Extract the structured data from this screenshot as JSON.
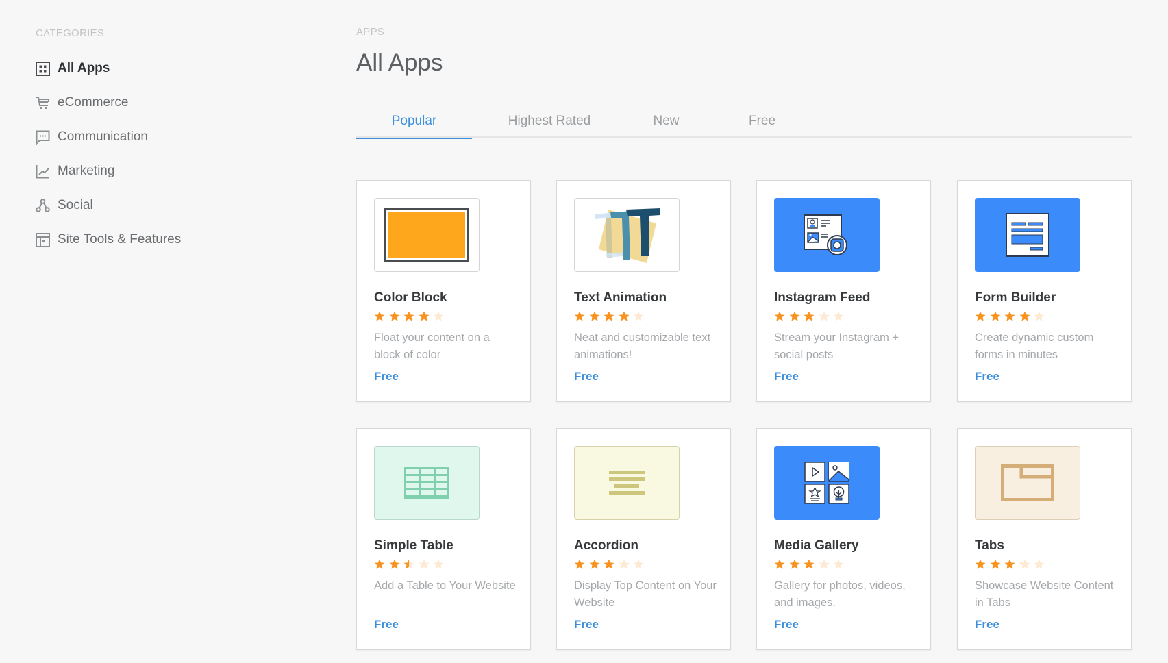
{
  "sidebar": {
    "heading": "CATEGORIES",
    "items": [
      {
        "label": "All Apps",
        "icon": "grid-icon",
        "active": true
      },
      {
        "label": "eCommerce",
        "icon": "cart-icon",
        "active": false
      },
      {
        "label": "Communication",
        "icon": "chat-bubble-icon",
        "active": false
      },
      {
        "label": "Marketing",
        "icon": "line-chart-icon",
        "active": false
      },
      {
        "label": "Social",
        "icon": "share-nodes-icon",
        "active": false
      },
      {
        "label": "Site Tools & Features",
        "icon": "layout-icon",
        "active": false
      }
    ]
  },
  "main": {
    "breadcrumb": "APPS",
    "title": "All Apps",
    "tabs": [
      {
        "label": "Popular",
        "active": true
      },
      {
        "label": "Highest Rated",
        "active": false
      },
      {
        "label": "New",
        "active": false
      },
      {
        "label": "Free",
        "active": false
      }
    ]
  },
  "apps": [
    {
      "name": "Color Block",
      "rating": 4,
      "description": "Float your content on a block of color",
      "price": "Free",
      "icon": "color-block-icon"
    },
    {
      "name": "Text Animation",
      "rating": 4,
      "description": "Neat and customizable text animations!",
      "price": "Free",
      "icon": "text-animation-icon"
    },
    {
      "name": "Instagram Feed",
      "rating": 3,
      "description": "Stream your Instagram + social posts",
      "price": "Free",
      "icon": "instagram-feed-icon"
    },
    {
      "name": "Form Builder",
      "rating": 4,
      "description": "Create dynamic custom forms in minutes",
      "price": "Free",
      "icon": "form-builder-icon"
    },
    {
      "name": "Simple Table",
      "rating": 2.5,
      "description": "Add a Table to Your Website",
      "price": "Free",
      "icon": "table-icon"
    },
    {
      "name": "Accordion",
      "rating": 3,
      "description": "Display Top Content on Your Website",
      "price": "Free",
      "icon": "accordion-icon"
    },
    {
      "name": "Media Gallery",
      "rating": 3,
      "description": "Gallery for photos, videos, and images.",
      "price": "Free",
      "icon": "media-gallery-icon"
    },
    {
      "name": "Tabs",
      "rating": 3.1,
      "description": "Showcase Website Content in Tabs",
      "price": "Free",
      "icon": "tabs-icon"
    }
  ],
  "colors": {
    "accent": "#3d8fdc",
    "star_filled": "#f7931e",
    "star_empty": "#fde9d4"
  }
}
